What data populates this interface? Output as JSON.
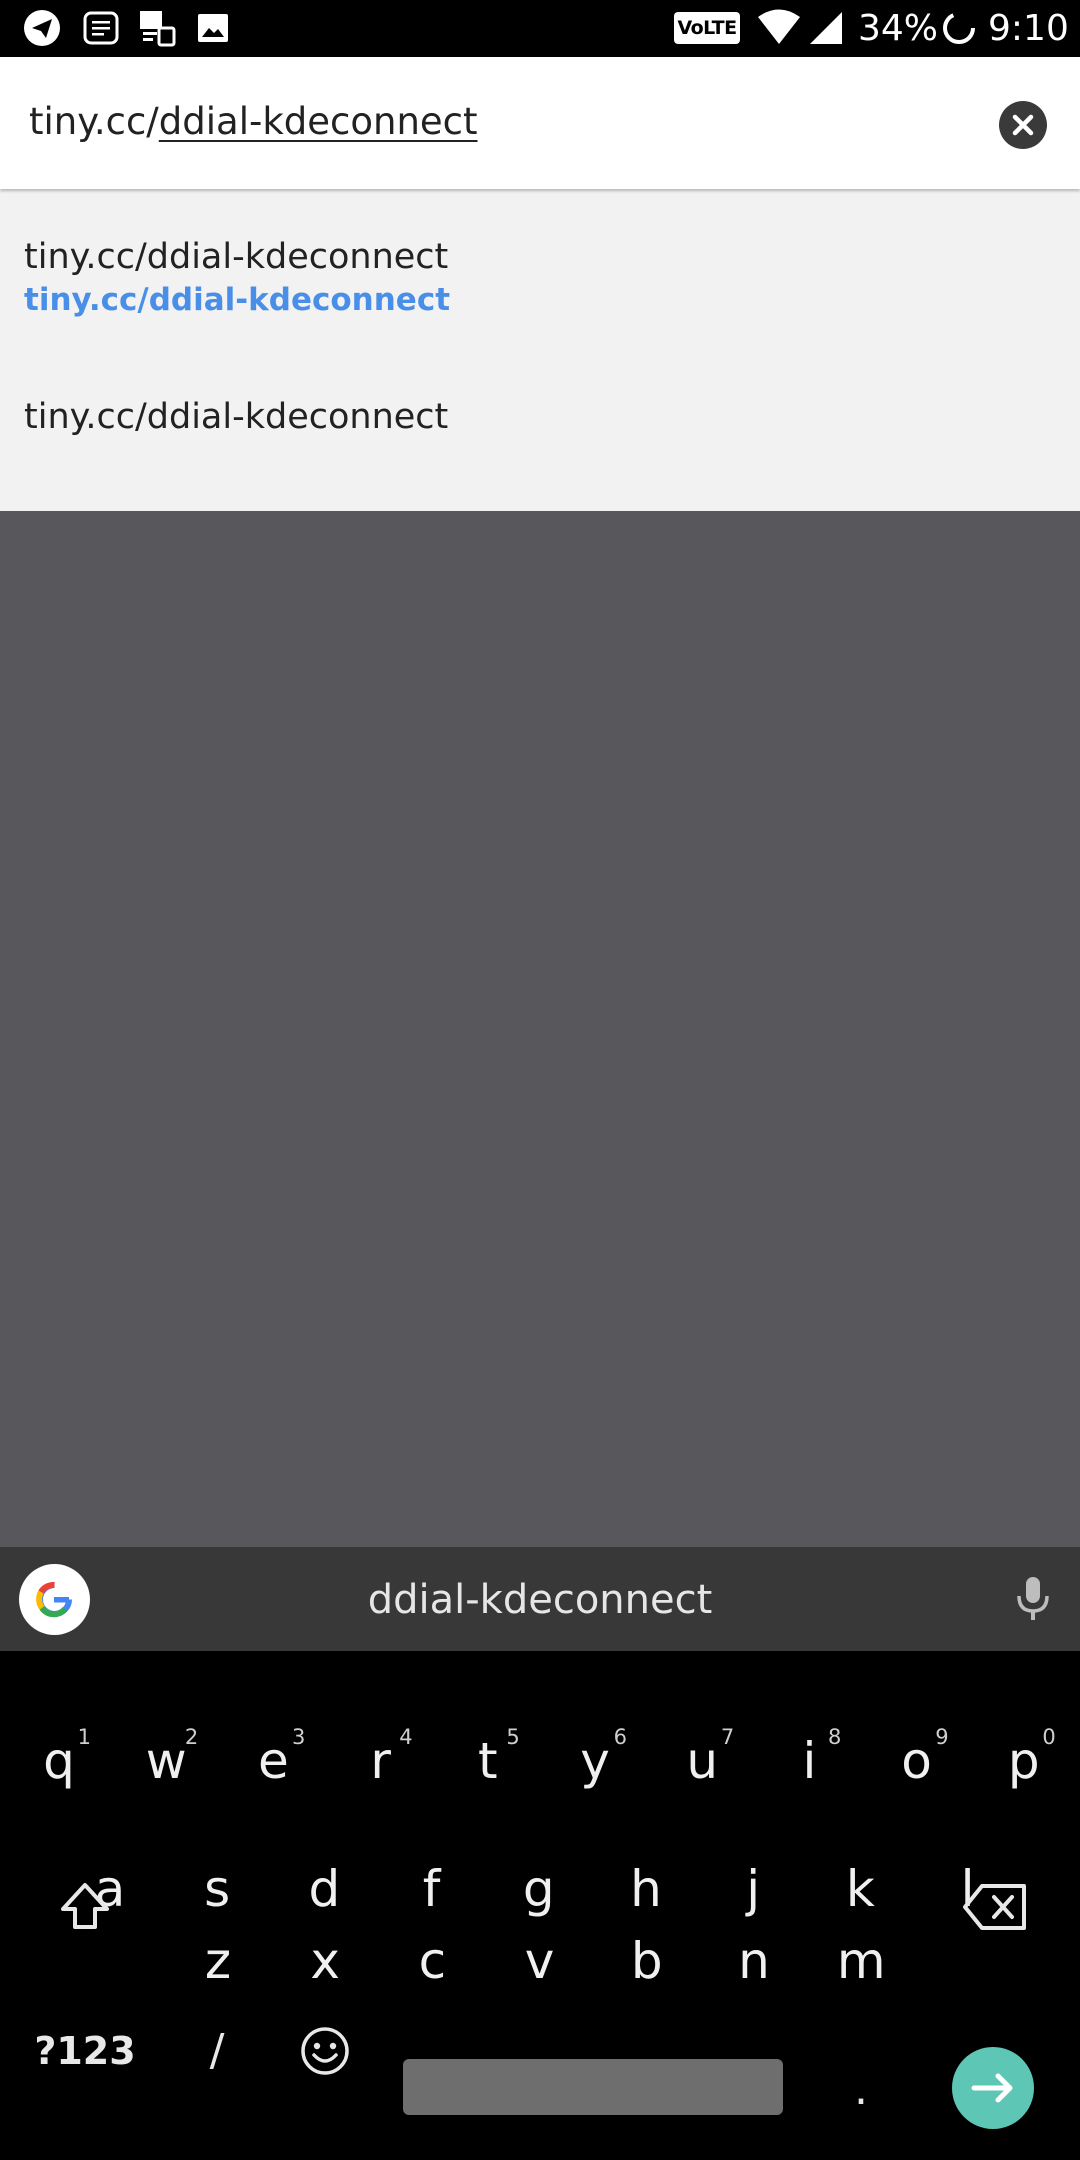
{
  "status_bar": {
    "volte": "VoLTE",
    "battery": "34%",
    "time": "9:10"
  },
  "url_bar": {
    "value_prefix": "tiny.cc/",
    "value_suffix": "ddial-kdeconnect"
  },
  "suggestions": [
    {
      "title": "tiny.cc/ddial-kdeconnect",
      "url": "tiny.cc/ddial-kdeconnect"
    },
    {
      "title": "tiny.cc/ddial-kdeconnect"
    }
  ],
  "keyboard": {
    "suggestion": "ddial-kdeconnect",
    "row1": [
      {
        "key": "q",
        "hint": "1"
      },
      {
        "key": "w",
        "hint": "2"
      },
      {
        "key": "e",
        "hint": "3"
      },
      {
        "key": "r",
        "hint": "4"
      },
      {
        "key": "t",
        "hint": "5"
      },
      {
        "key": "y",
        "hint": "6"
      },
      {
        "key": "u",
        "hint": "7"
      },
      {
        "key": "i",
        "hint": "8"
      },
      {
        "key": "o",
        "hint": "9"
      },
      {
        "key": "p",
        "hint": "0"
      }
    ],
    "row2": [
      "a",
      "s",
      "d",
      "f",
      "g",
      "h",
      "j",
      "k",
      "l"
    ],
    "row3": [
      "z",
      "x",
      "c",
      "v",
      "b",
      "n",
      "m"
    ],
    "symbols_label": "?123",
    "slash_label": "/",
    "period_label": "."
  },
  "colors": {
    "accent_link": "#4a8fe7",
    "enter_key": "#5ec6b5",
    "page_dim": "#58575b"
  },
  "icons": [
    "telegram-icon",
    "document-icon",
    "gallery-icon",
    "image-icon",
    "wifi-icon",
    "signal-icon",
    "battery-saver-icon",
    "clear-icon",
    "google-icon",
    "mic-icon",
    "shift-icon",
    "backspace-icon",
    "emoji-icon",
    "enter-arrow-icon"
  ]
}
